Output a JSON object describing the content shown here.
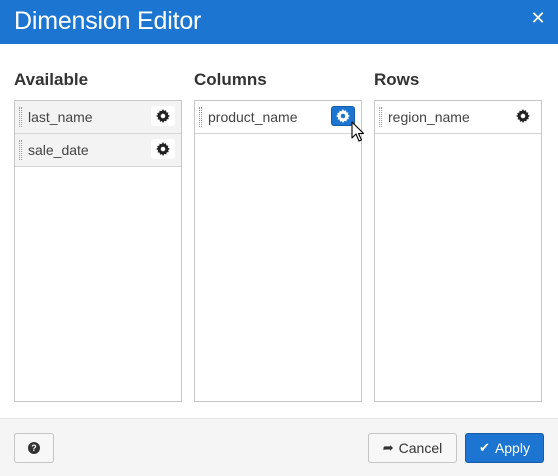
{
  "dialog": {
    "title": "Dimension Editor",
    "close_icon": "close-icon"
  },
  "columns": {
    "available": {
      "title": "Available",
      "items": [
        {
          "label": "last_name",
          "icon": "gear-icon"
        },
        {
          "label": "sale_date",
          "icon": "gear-icon"
        }
      ]
    },
    "columns": {
      "title": "Columns",
      "items": [
        {
          "label": "product_name",
          "icon": "gear-icon",
          "state": "hovered"
        }
      ]
    },
    "rows": {
      "title": "Rows",
      "items": [
        {
          "label": "region_name",
          "icon": "gear-icon"
        }
      ]
    }
  },
  "footer": {
    "help_icon": "question-circle-icon",
    "cancel_label": "Cancel",
    "cancel_icon": "share-arrow-icon",
    "apply_label": "Apply",
    "apply_icon": "check-icon"
  },
  "colors": {
    "accent": "#1c75d0",
    "item_background": "#f3f3f3"
  }
}
